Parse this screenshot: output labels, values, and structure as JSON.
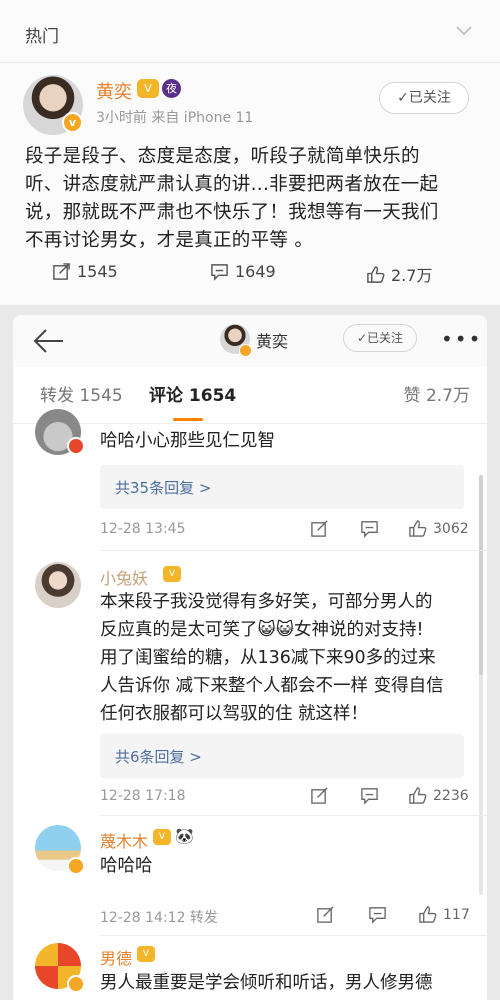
{
  "top": {
    "section_label": "热门"
  },
  "post": {
    "author": "黄奕",
    "badge_crown": "V",
    "badge_moon": "夜",
    "meta": "3小时前  来自 iPhone 11",
    "follow_label": "✓已关注",
    "lines": [
      "段子是段子、态度是态度，听段子就简单快乐的",
      "听、讲态度就严肃认真的讲...非要把两者放在一起",
      "说，那就既不严肃也不快乐了！我想等有一天我们",
      "不再讨论男女，才是真正的平等 。"
    ],
    "repost_count": "1545",
    "comment_count": "1649",
    "like_count": "2.7万"
  },
  "detail": {
    "nav_name": "黄奕",
    "nav_follow": "✓已关注",
    "more": "•••",
    "tab_repost": "转发 1545",
    "tab_comment": "评论 1654",
    "tab_like": "赞 2.7万"
  },
  "comments": [
    {
      "name": "",
      "text_lines": [
        "哈哈小心那些见仁见智"
      ],
      "replies": "共35条回复 >",
      "time": "12-28 13:45",
      "likes": "3062"
    },
    {
      "name": "小兔妖",
      "text_lines": [
        "本来段子我没觉得有多好笑，可部分男人的",
        "反应真的是太可笑了😺😺女神说的对支持!",
        "用了闺蜜给的糖，从136减下来90多的过来",
        "人告诉你 减下来整个人都会不一样 变得自信",
        "任何衣服都可以驾驭的住 就这样！"
      ],
      "replies": "共6条回复 >",
      "time": "12-28 17:18",
      "likes": "2236"
    },
    {
      "name": "蔑木木",
      "emoji": "🐼",
      "text_lines": [
        "哈哈哈"
      ],
      "time": "12-28 14:12  转发",
      "likes": "117"
    },
    {
      "name": "男德",
      "text_lines": [
        "男人最重要是学会倾听和听话，男人修男德"
      ]
    }
  ],
  "colors": {
    "accent": "#e8802b",
    "link": "#4d6ea0",
    "tab_indicator": "#ff8200"
  }
}
